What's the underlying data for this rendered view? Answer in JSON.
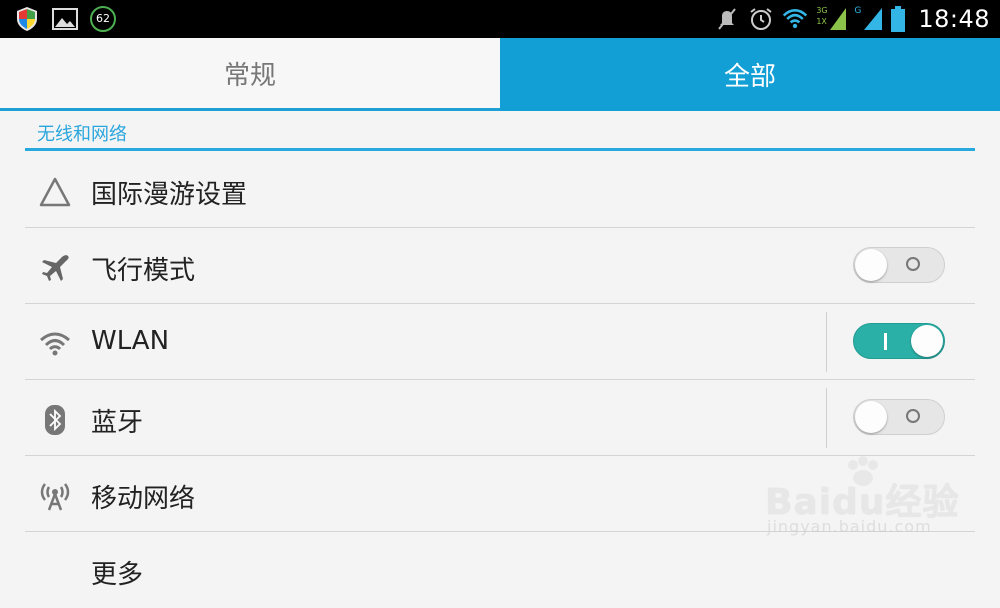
{
  "status_bar": {
    "left_icons": [
      "shield-icon",
      "image-icon",
      "battery-percent-icon"
    ],
    "battery_badge": "62",
    "right_icons": [
      "mute-icon",
      "alarm-icon",
      "wifi-icon",
      "signal-3g-icon",
      "signal-g-icon",
      "battery-icon"
    ],
    "signal_3g_label": "3G",
    "signal_1x_label": "1X",
    "signal_g_label": "G",
    "time": "18:48"
  },
  "tabs": [
    {
      "label": "常规",
      "selected": false
    },
    {
      "label": "全部",
      "selected": true
    }
  ],
  "section": {
    "title": "无线和网络"
  },
  "items": [
    {
      "label": "国际漫游设置",
      "icon": "triangle-icon"
    },
    {
      "label": "飞行模式",
      "icon": "airplane-icon",
      "toggle": "off"
    },
    {
      "label": "WLAN",
      "icon": "wifi-icon",
      "toggle": "on"
    },
    {
      "label": "蓝牙",
      "icon": "bluetooth-icon",
      "toggle": "off"
    },
    {
      "label": "移动网络",
      "icon": "antenna-icon"
    },
    {
      "label": "更多",
      "icon": "more-icon"
    }
  ],
  "watermark": {
    "logo": "Baidu经验",
    "url": "jingyan.baidu.com"
  },
  "colors": {
    "accent": "#119fd6",
    "toggle_on": "#2bb0a8",
    "section_text": "#2aa6dd"
  }
}
